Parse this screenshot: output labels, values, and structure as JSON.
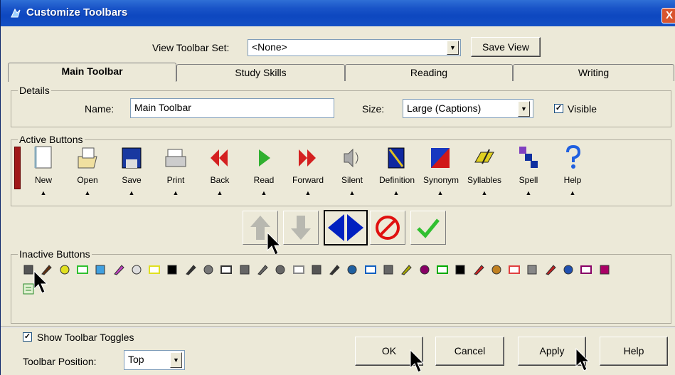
{
  "window": {
    "title": "Customize Toolbars",
    "close": "X"
  },
  "view_set": {
    "label": "View Toolbar Set:",
    "value": "<None>",
    "save_view": "Save View"
  },
  "tabs": [
    {
      "label": "Main Toolbar"
    },
    {
      "label": "Study Skills"
    },
    {
      "label": "Reading"
    },
    {
      "label": "Writing"
    }
  ],
  "details": {
    "title": "Details",
    "name_label": "Name:",
    "name_value": "Main Toolbar",
    "size_label": "Size:",
    "size_value": "Large (Captions)",
    "visible_label": "Visible",
    "visible_checked": "✓"
  },
  "active": {
    "title": "Active Buttons",
    "buttons": [
      "New",
      "Open",
      "Save",
      "Print",
      "Back",
      "Read",
      "Forward",
      "Silent",
      "Definition",
      "Synonym",
      "Syllables",
      "Spell",
      "Help"
    ]
  },
  "inactive": {
    "title": "Inactive Buttons"
  },
  "footer": {
    "show_toggles": "Show Toolbar Toggles",
    "show_toggles_checked": "✓",
    "position_label": "Toolbar Position:",
    "position_value": "Top",
    "ok": "OK",
    "cancel": "Cancel",
    "apply": "Apply",
    "help": "Help"
  },
  "colors": {
    "title_bar": "#0d47c0",
    "dialog_bg": "#ece9d8",
    "arrow_red": "#d42020",
    "arrow_blue": "#0020c0",
    "check_green": "#30c030"
  }
}
